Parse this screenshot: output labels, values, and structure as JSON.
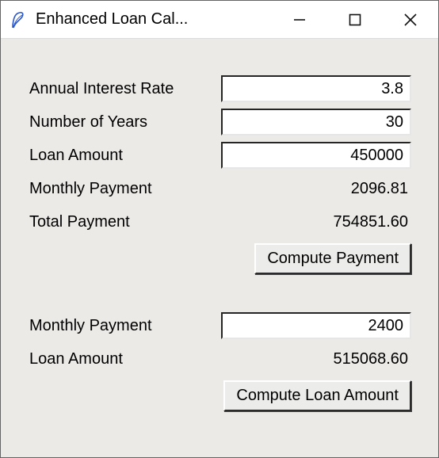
{
  "window": {
    "title": "Enhanced Loan Cal..."
  },
  "section1": {
    "labels": {
      "annual_interest_rate": "Annual Interest Rate",
      "number_of_years": "Number of Years",
      "loan_amount": "Loan Amount",
      "monthly_payment": "Monthly Payment",
      "total_payment": "Total Payment"
    },
    "inputs": {
      "annual_interest_rate": "3.8",
      "number_of_years": "30",
      "loan_amount": "450000"
    },
    "outputs": {
      "monthly_payment": "2096.81",
      "total_payment": "754851.60"
    },
    "button": "Compute Payment"
  },
  "section2": {
    "labels": {
      "monthly_payment": "Monthly Payment",
      "loan_amount": "Loan Amount"
    },
    "inputs": {
      "monthly_payment": "2400"
    },
    "outputs": {
      "loan_amount": "515068.60"
    },
    "button": "Compute Loan Amount"
  },
  "icons": {
    "app": "feather-icon",
    "minimize": "minimize-icon",
    "maximize": "maximize-icon",
    "close": "close-icon"
  }
}
